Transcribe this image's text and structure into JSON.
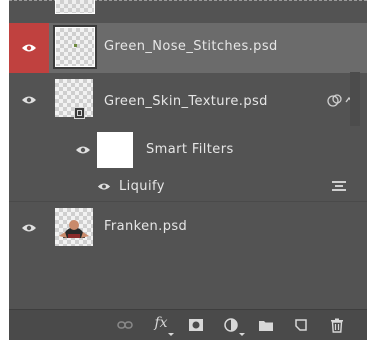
{
  "layers": [
    {
      "name": "Green_Nose_Stitches.psd",
      "selected": true,
      "visible": true,
      "type": "smart-object"
    },
    {
      "name": "Green_Skin_Texture.psd",
      "selected": false,
      "visible": true,
      "type": "smart-object-with-filters"
    },
    {
      "name": "Franken.psd",
      "selected": false,
      "visible": true,
      "type": "smart-object"
    }
  ],
  "smart_filters": {
    "group_label": "Smart Filters",
    "filters": [
      {
        "name": "Liquify"
      }
    ]
  },
  "toolbar": {
    "icons": [
      "link-layers-icon",
      "fx-icon",
      "add-mask-icon",
      "adjustment-layer-icon",
      "group-folder-icon",
      "new-layer-icon",
      "trash-icon"
    ],
    "fx_label": "fx"
  },
  "colors": {
    "panel_bg": "#535353",
    "selected_row": "#6b6b6b",
    "selected_eye_bg": "#c0413f",
    "text": "#e6e6e6"
  }
}
